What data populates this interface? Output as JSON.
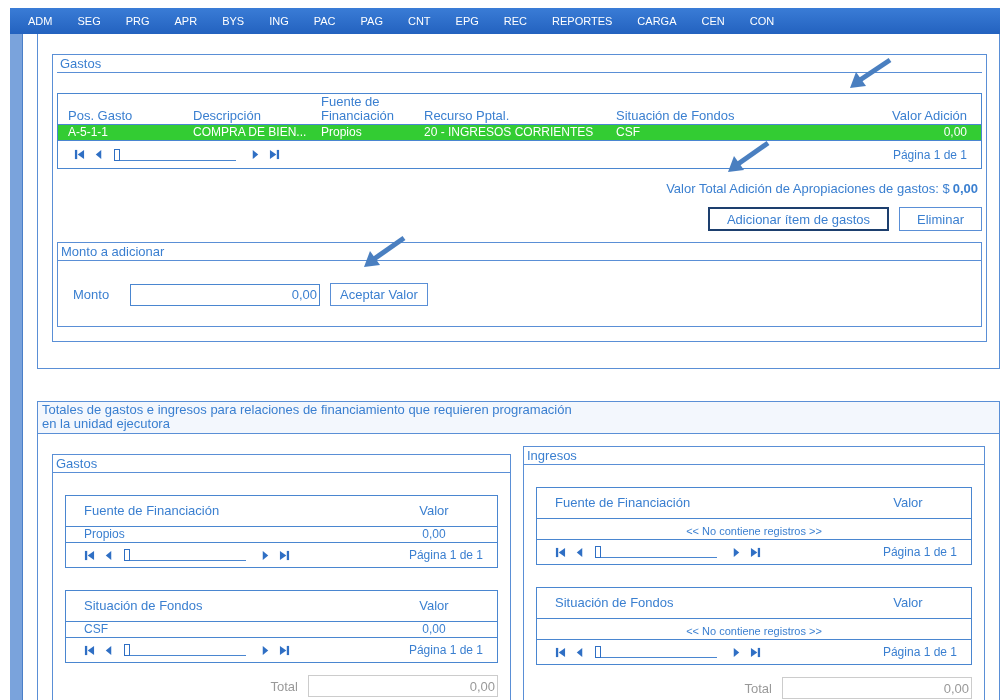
{
  "nav": [
    "ADM",
    "SEG",
    "PRG",
    "APR",
    "BYS",
    "ING",
    "PAC",
    "PAG",
    "CNT",
    "EPG",
    "REC",
    "REPORTES",
    "CARGA",
    "CEN",
    "CON"
  ],
  "gastos": {
    "title": "Gastos",
    "table": {
      "columns": [
        "Pos. Gasto",
        "Descripción",
        "Fuente de Financiación",
        "Recurso Pptal.",
        "Situación de Fondos",
        "Valor Adición"
      ],
      "rows": [
        {
          "cells": [
            "A-5-1-1",
            "COMPRA DE BIEN...",
            "Propios",
            "20 - INGRESOS CORRIENTES",
            "CSF",
            "0,00"
          ],
          "selected": true
        }
      ],
      "pager": {
        "label": "Página 1 de 1",
        "level": 0
      }
    },
    "total_label": "Valor Total Adición de Apropiaciones de gastos: $",
    "total_value": "0,00",
    "buttons": [
      {
        "label": "Adicionar ítem de gastos",
        "focused": true
      },
      {
        "label": "Eliminar",
        "focused": false
      }
    ],
    "monto": {
      "title": "Monto a adicionar",
      "label": "Monto",
      "value": "0,00",
      "button": "Aceptar Valor"
    }
  },
  "totales": {
    "title": "Totales de gastos e ingresos para relaciones de financiamiento que requieren programación en la unidad ejecutora",
    "panels": [
      {
        "title": "Gastos",
        "tables": [
          {
            "columns": [
              "Fuente de Financiación",
              "Valor"
            ],
            "rows": [
              [
                "Propios",
                "0,00"
              ]
            ],
            "pager": {
              "label": "Página 1 de 1",
              "level": 0
            }
          },
          {
            "columns": [
              "Situación de Fondos",
              "Valor"
            ],
            "rows": [
              [
                "CSF",
                "0,00"
              ]
            ],
            "pager": {
              "label": "Página 1 de 1",
              "level": 0
            }
          }
        ],
        "total_label": "Total",
        "total_value": "0,00"
      },
      {
        "title": "Ingresos",
        "tables": [
          {
            "columns": [
              "Fuente de Financiación",
              "Valor"
            ],
            "empty": "<< No contiene registros >>",
            "pager": {
              "label": "Página 1 de 1",
              "level": 0
            }
          },
          {
            "columns": [
              "Situación de Fondos",
              "Valor"
            ],
            "empty": "<< No contiene registros >>",
            "pager": {
              "label": "Página 1 de 1",
              "level": 0
            }
          }
        ],
        "total_label": "Total",
        "total_value": "0,00"
      }
    ]
  }
}
